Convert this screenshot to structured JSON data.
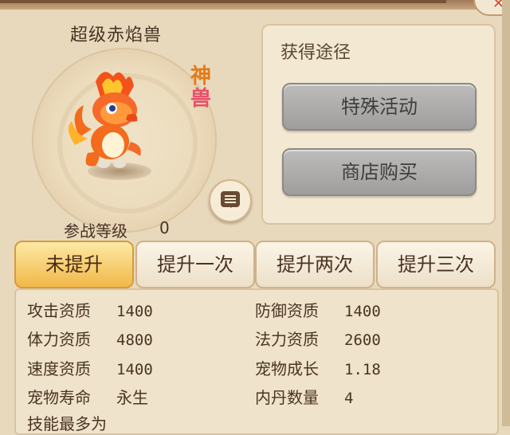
{
  "pet": {
    "name": "超级赤焰兽",
    "tag_line1": "神",
    "tag_line2": "兽",
    "level_label": "参战等级",
    "level_value": "0"
  },
  "acquire": {
    "title": "获得途径",
    "buttons": [
      "特殊活动",
      "商店购买"
    ]
  },
  "tabs": [
    "未提升",
    "提升一次",
    "提升两次",
    "提升三次"
  ],
  "active_tab": 0,
  "stats": [
    {
      "label": "攻击资质",
      "value": "1400"
    },
    {
      "label": "防御资质",
      "value": "1400"
    },
    {
      "label": "体力资质",
      "value": "4800"
    },
    {
      "label": "法力资质",
      "value": "2600"
    },
    {
      "label": "速度资质",
      "value": "1400"
    },
    {
      "label": "宠物成长",
      "value": "1.18"
    },
    {
      "label": "宠物寿命",
      "value": "永生"
    },
    {
      "label": "内丹数量",
      "value": "4"
    }
  ],
  "skill_line": "技能最多为",
  "icons": [
    "chat-icon",
    "close-icon"
  ]
}
